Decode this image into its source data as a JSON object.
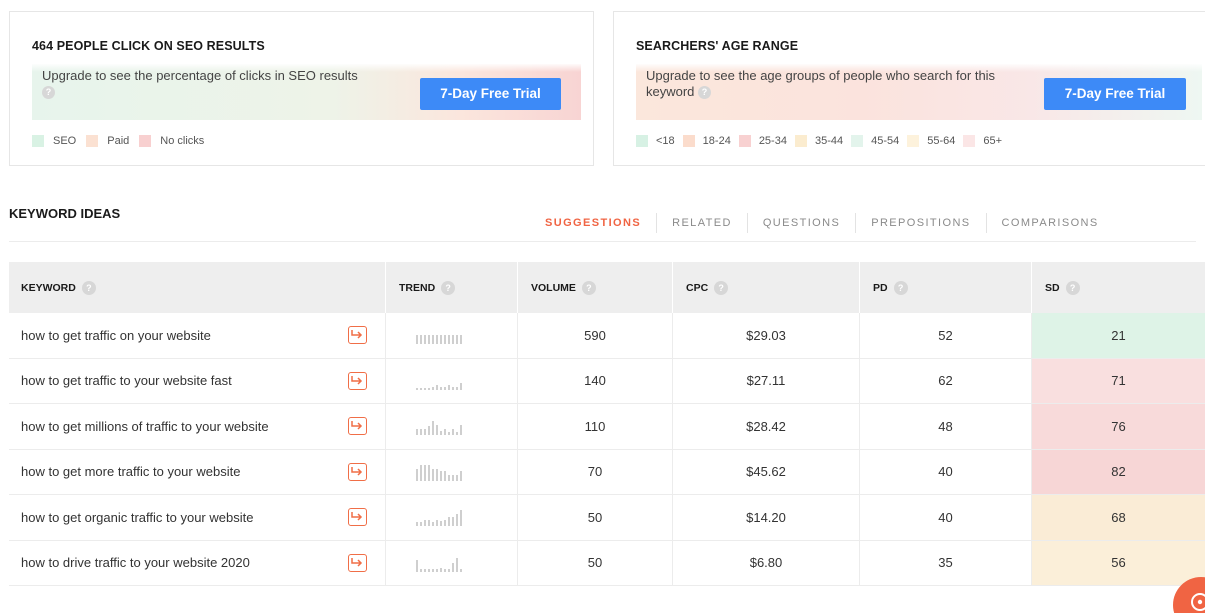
{
  "seo_card": {
    "title": "464 PEOPLE CLICK ON SEO RESULTS",
    "upgrade_text": "Upgrade to see the percentage of clicks in SEO results",
    "cta_label": "7-Day Free Trial",
    "legend": [
      {
        "label": "SEO",
        "color": "#d9f2e4"
      },
      {
        "label": "Paid",
        "color": "#fbe1d2"
      },
      {
        "label": "No clicks",
        "color": "#f8d0d0"
      }
    ]
  },
  "age_card": {
    "title": "SEARCHERS' AGE RANGE",
    "upgrade_text": "Upgrade to see the age groups of people who search for this keyword",
    "cta_label": "7-Day Free Trial",
    "legend": [
      {
        "label": "<18",
        "color": "#d7f1e4"
      },
      {
        "label": "18-24",
        "color": "#fbdccc"
      },
      {
        "label": "25-34",
        "color": "#f8d1d1"
      },
      {
        "label": "35-44",
        "color": "#fbeccf"
      },
      {
        "label": "45-54",
        "color": "#e3f4ec"
      },
      {
        "label": "55-64",
        "color": "#fdf2dc"
      },
      {
        "label": "65+",
        "color": "#fbe6e6"
      }
    ]
  },
  "keyword_ideas": {
    "title": "KEYWORD IDEAS",
    "tabs": [
      "SUGGESTIONS",
      "RELATED",
      "QUESTIONS",
      "PREPOSITIONS",
      "COMPARISONS"
    ],
    "active_tab": "SUGGESTIONS",
    "columns": [
      "KEYWORD",
      "TREND",
      "VOLUME",
      "CPC",
      "PD",
      "SD"
    ],
    "rows": [
      {
        "keyword": "how to get traffic on your website",
        "volume": "590",
        "cpc": "$29.03",
        "pd": "52",
        "sd": "21",
        "sd_color": "#def3e7",
        "trend": [
          9,
          9,
          9,
          9,
          9,
          9,
          9,
          9,
          9,
          9,
          9,
          9
        ]
      },
      {
        "keyword": "how to get traffic to your website fast",
        "volume": "140",
        "cpc": "$27.11",
        "pd": "62",
        "sd": "71",
        "sd_color": "#f9dfdf",
        "trend": [
          2,
          2,
          2,
          2,
          3,
          5,
          3,
          3,
          5,
          3,
          3,
          7
        ]
      },
      {
        "keyword": "how to get millions of traffic to your website",
        "volume": "110",
        "cpc": "$28.42",
        "pd": "48",
        "sd": "76",
        "sd_color": "#f8dada",
        "trend": [
          6,
          6,
          6,
          9,
          14,
          10,
          4,
          6,
          3,
          6,
          3,
          10
        ]
      },
      {
        "keyword": "how to get more traffic to your website",
        "volume": "70",
        "cpc": "$45.62",
        "pd": "40",
        "sd": "82",
        "sd_color": "#f7d6d6",
        "trend": [
          12,
          16,
          16,
          16,
          12,
          12,
          10,
          10,
          6,
          6,
          6,
          10
        ]
      },
      {
        "keyword": "how to get organic traffic to your website",
        "volume": "50",
        "cpc": "$14.20",
        "pd": "40",
        "sd": "68",
        "sd_color": "#faecd6",
        "trend": [
          4,
          4,
          6,
          6,
          4,
          6,
          5,
          6,
          9,
          9,
          12,
          16
        ]
      },
      {
        "keyword": "how to drive traffic to your website 2020",
        "volume": "50",
        "cpc": "$6.80",
        "pd": "35",
        "sd": "56",
        "sd_color": "#fbefd9",
        "trend": [
          12,
          3,
          3,
          3,
          3,
          3,
          4,
          3,
          3,
          9,
          14,
          3
        ]
      }
    ]
  }
}
